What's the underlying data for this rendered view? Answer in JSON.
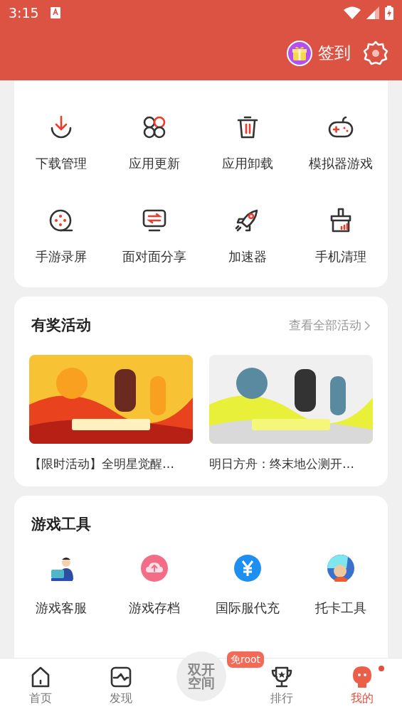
{
  "status_bar": {
    "time": "3:15"
  },
  "header": {
    "checkin": "签到"
  },
  "common_tools": {
    "items": [
      {
        "kind": "download",
        "label": "下载管理"
      },
      {
        "kind": "clover",
        "label": "应用更新"
      },
      {
        "kind": "trash",
        "label": "应用卸载"
      },
      {
        "kind": "gamepad",
        "label": "模拟器游戏"
      },
      {
        "kind": "reel",
        "label": "手游录屏"
      },
      {
        "kind": "monitor",
        "label": "面对面分享"
      },
      {
        "kind": "rocket",
        "label": "加速器"
      },
      {
        "kind": "brush",
        "label": "手机清理"
      }
    ]
  },
  "activities": {
    "title": "有奖活动",
    "more": "查看全部活动",
    "items": [
      {
        "kind": "picture",
        "caption": "【限时活动】全明星觉醒…"
      },
      {
        "kind": "picture",
        "caption": "明日方舟：终末地公测开…"
      }
    ]
  },
  "game_tools": {
    "title": "游戏工具",
    "items": [
      {
        "kind": "agent",
        "label": "游戏客服"
      },
      {
        "kind": "cloud",
        "label": "游戏存档"
      },
      {
        "kind": "yen",
        "label": "国际服代充"
      },
      {
        "kind": "avatar",
        "label": "托卡工具"
      }
    ]
  },
  "nav": {
    "items": [
      {
        "kind": "home",
        "label": "首页",
        "selected": false
      },
      {
        "kind": "pulse",
        "label": "发现",
        "selected": false
      },
      {
        "kind": "center",
        "label": "双开空间",
        "badge": "免root",
        "selected": false
      },
      {
        "kind": "trophy",
        "label": "排行",
        "selected": false
      },
      {
        "kind": "me",
        "label": "我的",
        "selected": true,
        "dot": true
      }
    ]
  }
}
